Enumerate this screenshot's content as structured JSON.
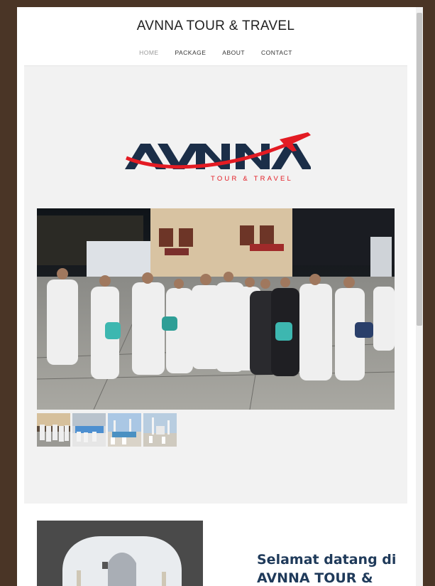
{
  "site": {
    "title": "AVNNA TOUR & TRAVEL"
  },
  "nav": {
    "items": [
      {
        "label": "HOME"
      },
      {
        "label": "PACKAGE"
      },
      {
        "label": "ABOUT"
      },
      {
        "label": "CONTACT"
      }
    ]
  },
  "logo": {
    "wordmark": "AVNNA",
    "tagline": "TOUR & TRAVEL",
    "colors": {
      "primary": "#1b2e48",
      "accent": "#e31b23"
    }
  },
  "gallery": {
    "main_image": "group-of-pilgrims-photo",
    "thumbnails": 4
  },
  "welcome": {
    "heading_line1": "Selamat datang di",
    "heading_line2": "AVNNA TOUR &"
  }
}
